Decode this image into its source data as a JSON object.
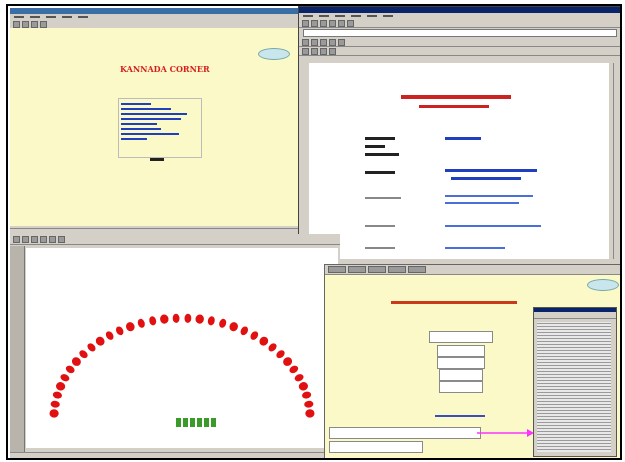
{
  "windows": {
    "kannada_corner": {
      "heading": "KANNADA CORNER",
      "button_label": "",
      "links": [
        "",
        "",
        "",
        "",
        "",
        "",
        "",
        ""
      ],
      "footer": ""
    },
    "browser": {
      "heading": "",
      "subheading": "",
      "rows": [
        {
          "label": "",
          "link": ""
        },
        {
          "label": "",
          "link": ""
        },
        {
          "label": "",
          "link": ""
        },
        {
          "label": "",
          "link": ""
        },
        {
          "label": "",
          "link": ""
        }
      ]
    },
    "arc_slide": {
      "arc_text": "",
      "bottom_text": "",
      "top_right_text": ""
    },
    "lower_right": {
      "header": "",
      "menu_boxes": [
        "",
        "",
        "",
        "",
        ""
      ],
      "bottom_boxes": [
        "",
        ""
      ]
    }
  },
  "colors": {
    "page_yellow": "#fbf9c8",
    "heading_red": "#d62020",
    "arc_red": "#e11111",
    "green_text": "#3a9a2a",
    "link_blue": "#1f3fbf",
    "arrow_magenta": "#ff33ff",
    "title_bar": "#0a246a"
  },
  "icons": [
    "arrow-right-icon",
    "toolbar-button-icon",
    "scrollbar-icon"
  ]
}
